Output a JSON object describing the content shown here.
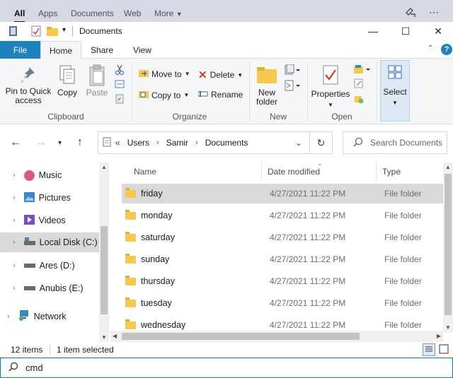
{
  "search_header": {
    "tabs": [
      "All",
      "Apps",
      "Documents",
      "Web",
      "More"
    ]
  },
  "window": {
    "title": "Documents",
    "minimize": "—",
    "maximize": "☐",
    "close": "✕"
  },
  "ribbon_tabs": [
    "File",
    "Home",
    "Share",
    "View"
  ],
  "ribbon": {
    "clipboard": {
      "pin": "Pin to Quick access",
      "pin_line1": "Pin to Quick",
      "pin_line2": "access",
      "copy": "Copy",
      "paste": "Paste",
      "label": "Clipboard"
    },
    "organize": {
      "move_to": "Move to",
      "copy_to": "Copy to",
      "delete": "Delete",
      "rename": "Rename",
      "label": "Organize"
    },
    "new": {
      "new_folder_line1": "New",
      "new_folder_line2": "folder",
      "label": "New"
    },
    "open": {
      "properties": "Properties",
      "label": "Open"
    },
    "select": {
      "select": "Select"
    }
  },
  "address": {
    "crumbs": [
      "Users",
      "Samir",
      "Documents"
    ],
    "search_placeholder": "Search Documents"
  },
  "nav_pane": {
    "items": [
      {
        "label": "Music",
        "icon": "music-icon"
      },
      {
        "label": "Pictures",
        "icon": "pictures-icon"
      },
      {
        "label": "Videos",
        "icon": "videos-icon"
      },
      {
        "label": "Local Disk (C:)",
        "icon": "drive-icon"
      },
      {
        "label": "Ares (D:)",
        "icon": "drive-icon"
      },
      {
        "label": "Anubis (E:)",
        "icon": "drive-icon"
      },
      {
        "label": "Network",
        "icon": "network-icon"
      }
    ]
  },
  "file_list": {
    "columns": [
      "Name",
      "Date modified",
      "Type"
    ],
    "rows": [
      {
        "name": "friday",
        "date": "4/27/2021 11:22 PM",
        "type": "File folder"
      },
      {
        "name": "monday",
        "date": "4/27/2021 11:22 PM",
        "type": "File folder"
      },
      {
        "name": "saturday",
        "date": "4/27/2021 11:22 PM",
        "type": "File folder"
      },
      {
        "name": "sunday",
        "date": "4/27/2021 11:22 PM",
        "type": "File folder"
      },
      {
        "name": "thursday",
        "date": "4/27/2021 11:22 PM",
        "type": "File folder"
      },
      {
        "name": "tuesday",
        "date": "4/27/2021 11:22 PM",
        "type": "File folder"
      },
      {
        "name": "wednesday",
        "date": "4/27/2021 11:22 PM",
        "type": "File folder"
      }
    ]
  },
  "status": {
    "count": "12 items",
    "selected": "1 item selected"
  },
  "search_input": {
    "value": "cmd"
  }
}
